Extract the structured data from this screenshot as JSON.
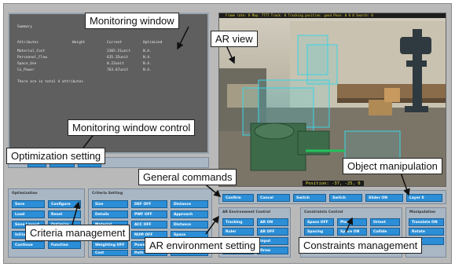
{
  "monitoring": {
    "title": "Summary",
    "headers": [
      "Attributes",
      "Weight",
      "Current",
      "Optimized"
    ],
    "rows": [
      [
        "Material_Cost",
        "",
        "2365.51unit",
        "N.A."
      ],
      [
        "Personnel_Flow",
        "",
        "635.35unit",
        "N.A."
      ],
      [
        "Space_Use",
        "",
        "0.22unit",
        "N.A."
      ],
      [
        "Cu_Power",
        "",
        "763.67unit",
        "N.A."
      ]
    ],
    "footer": "There are in total 4 attributes"
  },
  "ar": {
    "status": "Frame rate: 8  Map: 7777  Track: 0  Tracking position: good  Pose: 0 0 0  Search: 0",
    "position": "Position: -37, -25, 0"
  },
  "monitor_controls": [
    "Clear",
    "Previous",
    "Next"
  ],
  "optimization": {
    "title": "Optimization",
    "buttons": [
      "Save",
      "Configure",
      "Load",
      "Reset",
      "Save Layout",
      "Optimize",
      "Initialization",
      "Delete",
      "Continue",
      "Function"
    ]
  },
  "criteria": {
    "title": "Criteria Setting",
    "buttons": [
      "Size",
      "DEF OFF",
      "Distance",
      "Details",
      "PWF OFF",
      "Approach",
      "Material",
      "ACC OFF",
      "Distance",
      "Wall",
      "NUM OFF",
      "Space",
      "Weighting OFF",
      "Power",
      "Crane",
      "Cost",
      "Path",
      "Material"
    ]
  },
  "commands": [
    "Confirm",
    "Cancel",
    "Switch",
    "Switch",
    "Slider ON",
    "Layer 0"
  ],
  "ar_env": {
    "title": "AR Environment Control",
    "buttons": [
      "Tracking",
      "AR ON",
      "Ruler",
      "AR OFF",
      "Track",
      "Input",
      "Restore",
      "Draw",
      "Reset",
      "Sketch"
    ]
  },
  "constraints": {
    "title": "Constraints Control",
    "buttons": [
      "Space OFF",
      "Plane",
      "Orient",
      "Spacing",
      "Space ON",
      "Collide",
      "Angle",
      "Axis",
      "Front",
      "Back"
    ]
  },
  "manipulation": {
    "title": "Manipulation",
    "buttons": [
      "Translate ON",
      "Rotate",
      "Scale"
    ]
  },
  "callouts": {
    "monitoring_window": "Monitoring window",
    "ar_view": "AR view",
    "monitoring_control": "Monitoring window control",
    "optimization_setting": "Optimization setting",
    "general_commands": "General commands",
    "object_manipulation": "Object manipulation",
    "criteria_management": "Criteria management",
    "ar_environment_setting": "AR environment setting",
    "constraints_management": "Constraints management"
  },
  "colors": {
    "button": "#2b8ed6",
    "panel": "#a9b6c4",
    "monitor_bg": "#5f5f5f",
    "ar_status_text": "#e6d93a"
  }
}
